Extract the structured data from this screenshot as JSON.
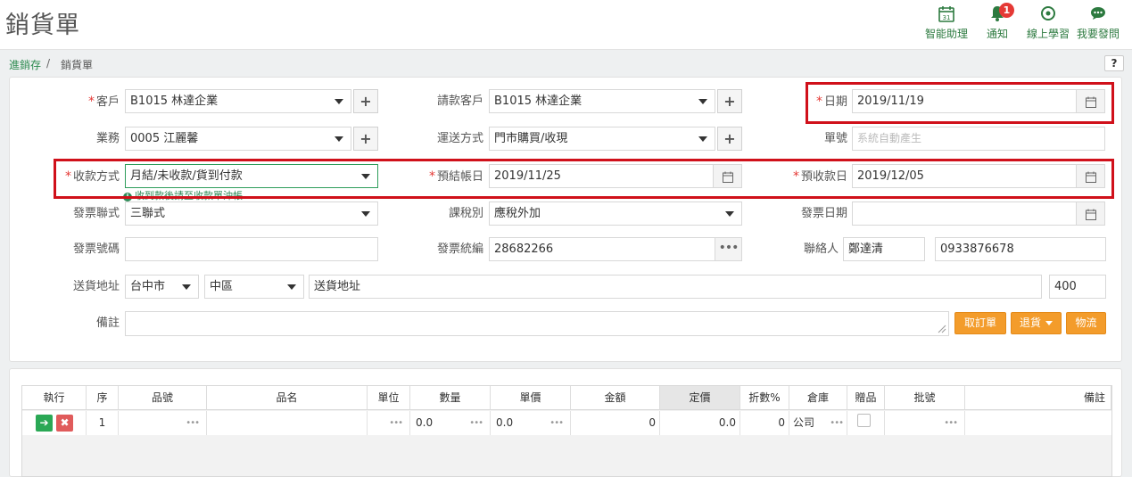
{
  "header": {
    "title": "銷貨單",
    "actions": [
      {
        "label": "智能助理",
        "icon": "calendar-icon"
      },
      {
        "label": "通知",
        "icon": "bell-icon",
        "badge": "1"
      },
      {
        "label": "線上學習",
        "icon": "compass-icon"
      },
      {
        "label": "我要發問",
        "icon": "chat-icon"
      }
    ]
  },
  "breadcrumb": {
    "parent": "進銷存",
    "separator": "/",
    "current": "銷貨單"
  },
  "help_label": "?",
  "form": {
    "customer": {
      "label": "客戶",
      "value": "B1015 林達企業"
    },
    "billing_customer": {
      "label": "請款客戶",
      "value": "B1015 林達企業"
    },
    "date": {
      "label": "日期",
      "value": "2019/11/19"
    },
    "salesperson": {
      "label": "業務",
      "value": "0005 江麗馨"
    },
    "shipping_method": {
      "label": "運送方式",
      "value": "門市購買/收現"
    },
    "doc_no": {
      "label": "單號",
      "placeholder": "系統自動產生"
    },
    "payment_method": {
      "label": "收款方式",
      "value": "月結/未收款/貨到付款",
      "hint": "收到款後請至收款單沖帳"
    },
    "settle_date": {
      "label": "預結帳日",
      "value": "2019/11/25"
    },
    "collect_date": {
      "label": "預收款日",
      "value": "2019/12/05"
    },
    "invoice_type": {
      "label": "發票聯式",
      "value": "三聯式"
    },
    "tax_type": {
      "label": "課稅別",
      "value": "應稅外加"
    },
    "invoice_date": {
      "label": "發票日期",
      "value": ""
    },
    "invoice_no": {
      "label": "發票號碼",
      "value": ""
    },
    "tax_id": {
      "label": "發票統編",
      "value": "28682266"
    },
    "contact": {
      "label": "聯絡人",
      "name": "鄭達清",
      "phone": "0933876678"
    },
    "address": {
      "label": "送貨地址",
      "city": "台中市",
      "district": "中區",
      "placeholder": "送貨地址",
      "zip": "400"
    },
    "note": {
      "label": "備註",
      "value": ""
    },
    "buttons": {
      "order": "取訂單",
      "return": "退貨",
      "logistics": "物流"
    }
  },
  "grid": {
    "headers": [
      "執行",
      "序",
      "品號",
      "品名",
      "單位",
      "數量",
      "單價",
      "金額",
      "定價",
      "折數%",
      "倉庫",
      "贈品",
      "批號",
      "備註"
    ],
    "rows": [
      {
        "seq": "1",
        "qty": "0.0",
        "price": "0.0",
        "amount": "0",
        "list_price": "0.0",
        "discount": "0",
        "warehouse": "公司"
      }
    ]
  },
  "colors": {
    "accent": "#2c8a4f",
    "required": "#e53935",
    "highlight": "#d0101a",
    "orange": "#f39c2b"
  }
}
